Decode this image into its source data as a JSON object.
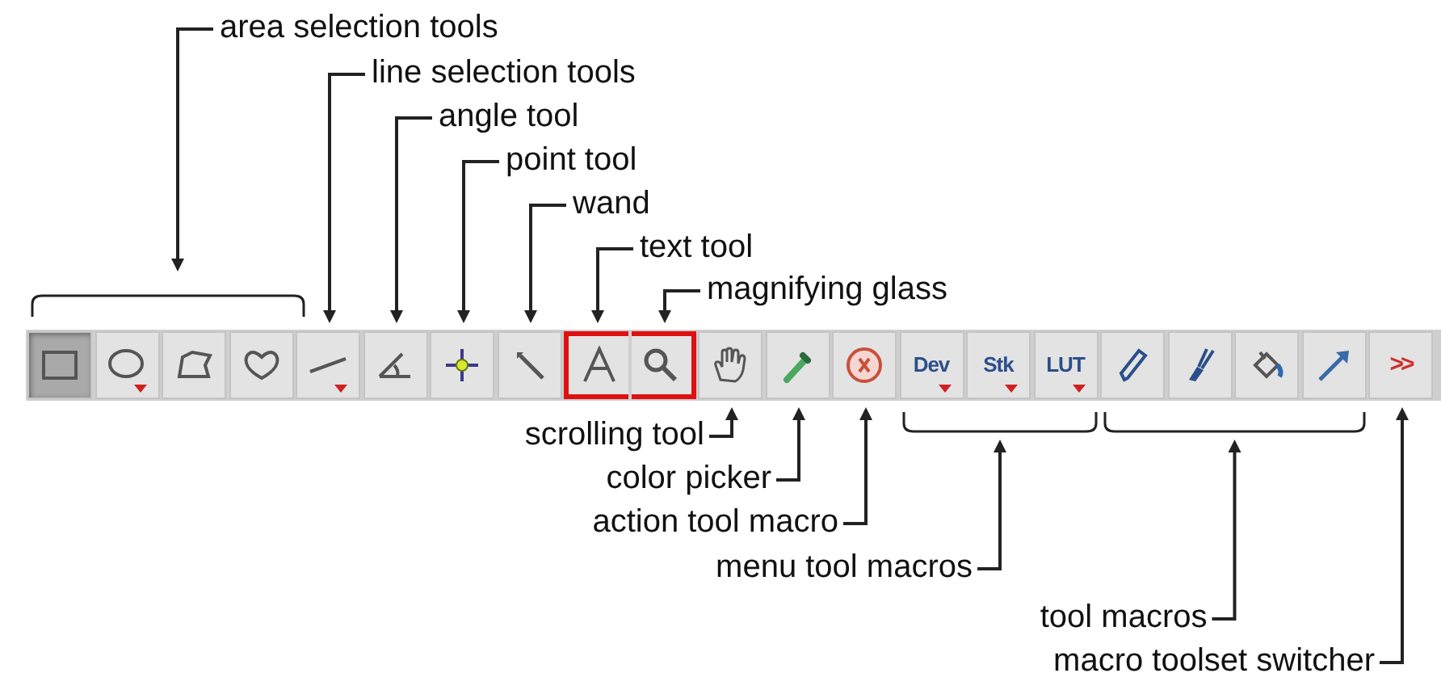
{
  "top_annotations": [
    {
      "text": "area selection tools"
    },
    {
      "text": "line selection tools"
    },
    {
      "text": "angle tool"
    },
    {
      "text": "point tool"
    },
    {
      "text": "wand"
    },
    {
      "text": "text tool"
    },
    {
      "text": "magnifying glass"
    }
  ],
  "toolbar": {
    "tools": [
      {
        "kind": "rectangle",
        "selected": true,
        "has_menu": false,
        "highlighted": false
      },
      {
        "kind": "oval",
        "selected": false,
        "has_menu": true,
        "highlighted": false
      },
      {
        "kind": "polygon",
        "selected": false,
        "has_menu": false,
        "highlighted": false
      },
      {
        "kind": "freehand",
        "selected": false,
        "has_menu": false,
        "highlighted": false
      },
      {
        "kind": "line",
        "selected": false,
        "has_menu": true,
        "highlighted": false
      },
      {
        "kind": "angle",
        "selected": false,
        "has_menu": false,
        "highlighted": false
      },
      {
        "kind": "point",
        "selected": false,
        "has_menu": false,
        "highlighted": false
      },
      {
        "kind": "wand",
        "selected": false,
        "has_menu": false,
        "highlighted": false
      },
      {
        "kind": "text",
        "selected": false,
        "has_menu": false,
        "highlighted": true
      },
      {
        "kind": "magnifier",
        "selected": false,
        "has_menu": false,
        "highlighted": true
      },
      {
        "kind": "hand",
        "selected": false,
        "has_menu": false,
        "highlighted": false
      },
      {
        "kind": "dropper",
        "selected": false,
        "has_menu": false,
        "highlighted": false
      },
      {
        "kind": "action",
        "selected": false,
        "has_menu": false,
        "highlighted": false
      },
      {
        "kind": "label",
        "label": "Dev",
        "selected": false,
        "has_menu": true,
        "highlighted": false
      },
      {
        "kind": "label",
        "label": "Stk",
        "selected": false,
        "has_menu": true,
        "highlighted": false
      },
      {
        "kind": "label",
        "label": "LUT",
        "selected": false,
        "has_menu": true,
        "highlighted": false
      },
      {
        "kind": "pencil",
        "selected": false,
        "has_menu": false,
        "highlighted": false
      },
      {
        "kind": "brush",
        "selected": false,
        "has_menu": false,
        "highlighted": false
      },
      {
        "kind": "fill",
        "selected": false,
        "has_menu": false,
        "highlighted": false
      },
      {
        "kind": "arrow",
        "selected": false,
        "has_menu": false,
        "highlighted": false
      },
      {
        "kind": "switcher",
        "label": ">>",
        "selected": false,
        "has_menu": false,
        "highlighted": false
      }
    ]
  },
  "bottom_annotations": [
    {
      "text": "scrolling tool"
    },
    {
      "text": "color picker"
    },
    {
      "text": "action tool macro"
    },
    {
      "text": "menu tool macros"
    },
    {
      "text": "tool macros"
    },
    {
      "text": "macro toolset switcher"
    }
  ]
}
